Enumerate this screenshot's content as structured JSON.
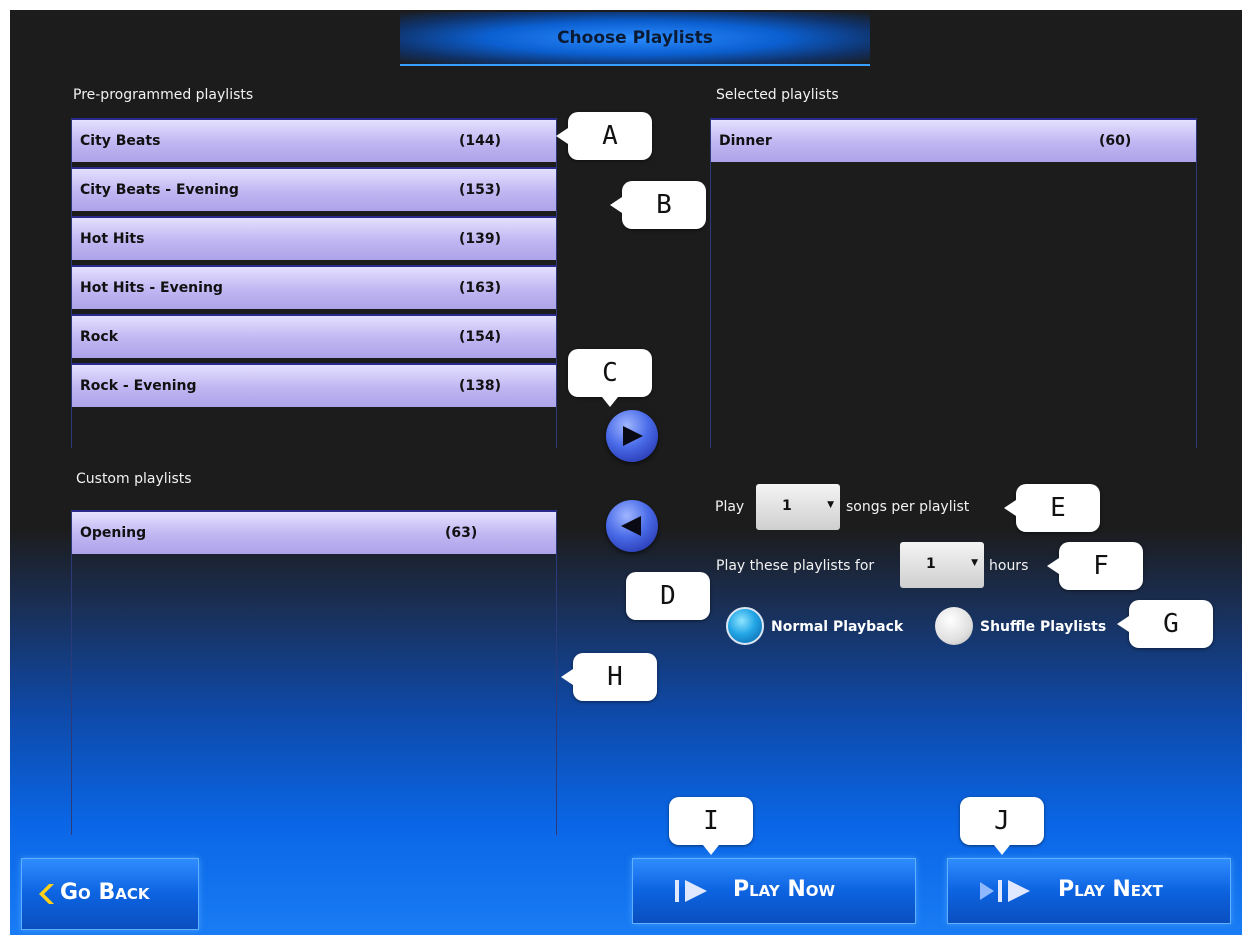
{
  "title": "Choose Playlists",
  "preprogrammed": {
    "label": "Pre-programmed playlists",
    "items": [
      {
        "name": "City Beats",
        "count": "(144)"
      },
      {
        "name": "City Beats - Evening",
        "count": "(153)"
      },
      {
        "name": "Hot Hits",
        "count": "(139)"
      },
      {
        "name": "Hot Hits - Evening",
        "count": "(163)"
      },
      {
        "name": "Rock",
        "count": "(154)"
      },
      {
        "name": "Rock - Evening",
        "count": "(138)"
      }
    ]
  },
  "custom": {
    "label": "Custom playlists",
    "items": [
      {
        "name": "Opening",
        "count": "(63)"
      }
    ]
  },
  "selected": {
    "label": "Selected playlists",
    "items": [
      {
        "name": "Dinner",
        "count": "(60)"
      }
    ]
  },
  "controls": {
    "play_prefix": "Play",
    "songs_value": "1",
    "songs_suffix": "songs per playlist",
    "hours_prefix": "Play these playlists for",
    "hours_value": "1",
    "hours_suffix": "hours",
    "normal_playback": "Normal Playback",
    "shuffle_playlists": "Shuffle Playlists"
  },
  "callouts": {
    "a": "A",
    "b": "B",
    "c": "C",
    "d": "D",
    "e": "E",
    "f": "F",
    "g": "G",
    "h": "H",
    "i": "I",
    "j": "J"
  },
  "buttons": {
    "go_back": "Go Back",
    "play_now": "Play Now",
    "play_next": "Play Next"
  },
  "icons": {
    "add": "play-right-arrow-icon",
    "remove": "play-left-arrow-icon",
    "back": "chevron-left-icon",
    "play_now": "skip-play-icon",
    "play_next": "next-play-icon"
  },
  "colors": {
    "row_fill": "#bfb6f2",
    "accent_blue": "#0d63e0",
    "background_dark": "#1c1c1c"
  }
}
